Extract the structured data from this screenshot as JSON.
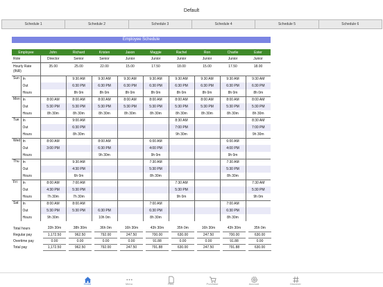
{
  "app": {
    "title": "Default"
  },
  "tabs": [
    "Schedule 1",
    "Schedule 2",
    "Schedule 3",
    "Schedule 4",
    "Schedule 5",
    "Schedule 6"
  ],
  "sheet": {
    "banner": "Employee Schedule",
    "header_label": "Employee",
    "role_label": "Role",
    "rate_label": "Hourly Rate (INR)",
    "employees": [
      {
        "name": "John",
        "role": "Director",
        "rate": "35.00"
      },
      {
        "name": "Richard",
        "role": "Senior",
        "rate": "25.00"
      },
      {
        "name": "Kristen",
        "role": "Senior",
        "rate": "22.00"
      },
      {
        "name": "Jason",
        "role": "Junior",
        "rate": "15.00"
      },
      {
        "name": "Maggie",
        "role": "Junior",
        "rate": "17.50"
      },
      {
        "name": "Rachel",
        "role": "Junior",
        "rate": "18.00"
      },
      {
        "name": "Ron",
        "role": "Junior",
        "rate": "15.00"
      },
      {
        "name": "Charlie",
        "role": "Junior",
        "rate": "17.50"
      },
      {
        "name": "Ester",
        "role": "Junior",
        "rate": "18.00"
      }
    ],
    "row_labels": [
      "In",
      "Out",
      "Hours"
    ],
    "days": [
      {
        "day": "Sun",
        "in": [
          "",
          "9:30 AM",
          "9:30 AM",
          "9:30 AM",
          "9:30 AM",
          "9:30 AM",
          "9:30 AM",
          "9:30 AM",
          "9:30 AM"
        ],
        "out": [
          "",
          "6:30 PM",
          "6:30 PM",
          "6:30 PM",
          "6:30 PM",
          "6:30 PM",
          "6:30 PM",
          "6:30 PM",
          "6:30 PM"
        ],
        "hours": [
          "",
          "8h 0m",
          "8h 0m",
          "8h 0m",
          "8h 0m",
          "8h 0m",
          "8h 0m",
          "8h 0m",
          "8h 0m"
        ]
      },
      {
        "day": "Mon",
        "in": [
          "8:00 AM",
          "8:00 AM",
          "8:00 AM",
          "8:00 AM",
          "8:00 AM",
          "8:00 AM",
          "8:00 AM",
          "8:00 AM",
          "8:00 AM"
        ],
        "out": [
          "5:30 PM",
          "5:30 PM",
          "5:30 PM",
          "5:30 PM",
          "5:30 PM",
          "5:30 PM",
          "5:30 PM",
          "5:30 PM",
          "5:30 PM"
        ],
        "hours": [
          "8h 30m",
          "8h 30m",
          "8h 30m",
          "8h 30m",
          "8h 30m",
          "8h 30m",
          "8h 30m",
          "8h 30m",
          "8h 30m"
        ]
      },
      {
        "day": "Tue",
        "in": [
          "",
          "9:00 AM",
          "",
          "",
          "",
          "8:30 AM",
          "",
          "",
          "8:30 AM"
        ],
        "out": [
          "",
          "6:30 PM",
          "",
          "",
          "",
          "7:00 PM",
          "",
          "",
          "7:00 PM"
        ],
        "hours": [
          "",
          "8h 30m",
          "",
          "",
          "",
          "9h 30m",
          "",
          "",
          "9h 30m"
        ]
      },
      {
        "day": "Wed",
        "in": [
          "8:00 AM",
          "",
          "8:00 AM",
          "",
          "6:00 AM",
          "",
          "",
          "6:00 AM",
          ""
        ],
        "out": [
          "3:00 PM",
          "",
          "6:30 PM",
          "",
          "4:00 PM",
          "",
          "",
          "4:00 PM",
          ""
        ],
        "hours": [
          "",
          "",
          "9h 30m",
          "",
          "9h 0m",
          "",
          "",
          "9h 0m",
          ""
        ]
      },
      {
        "day": "Thu",
        "in": [
          "",
          "9:30 AM",
          "",
          "",
          "7:30 AM",
          "",
          "",
          "7:30 AM",
          ""
        ],
        "out": [
          "",
          "4:30 PM",
          "",
          "",
          "5:30 PM",
          "",
          "",
          "5:30 PM",
          ""
        ],
        "hours": [
          "",
          "6h 0m",
          "",
          "",
          "8h 30m",
          "",
          "",
          "8h 30m",
          ""
        ]
      },
      {
        "day": "Fri",
        "in": [
          "8:00 AM",
          "7:00 AM",
          "",
          "",
          "",
          "7:30 AM",
          "",
          "",
          "7:30 AM"
        ],
        "out": [
          "4:30 PM",
          "5:30 PM",
          "",
          "",
          "",
          "5:30 PM",
          "",
          "",
          "5:30 PM"
        ],
        "hours": [
          "7h 30m",
          "7h 30m",
          "",
          "",
          "",
          "9h 0m",
          "",
          "",
          "9h 0m"
        ]
      },
      {
        "day": "Sat",
        "in": [
          "8:00 AM",
          "8:00 AM",
          "",
          "",
          "7:00 AM",
          "",
          "",
          "7:00 AM",
          ""
        ],
        "out": [
          "5:30 PM",
          "5:30 PM",
          "6:30 PM",
          "",
          "6:30 PM",
          "",
          "",
          "6:30 PM",
          ""
        ],
        "hours": [
          "9h 30m",
          "",
          "10h 0m",
          "",
          "8h 30m",
          "",
          "",
          "8h 30m",
          ""
        ]
      }
    ]
  },
  "totals": [
    {
      "label": "Total hours",
      "values": [
        "33h 30m",
        "38h 30m",
        "36h 0m",
        "16h 30m",
        "43h 30m",
        "35h 0m",
        "16h 30m",
        "43h 30m",
        "35h 0m"
      ]
    },
    {
      "label": "Regular pay",
      "values": [
        "1,172.50",
        "962.50",
        "792.00",
        "247.50",
        "700.00",
        "630.00",
        "247.50",
        "700.00",
        "630.00"
      ]
    },
    {
      "label": "Overtime pay",
      "values": [
        "0.00",
        "0.00",
        "0.00",
        "0.00",
        "91.88",
        "0.00",
        "0.00",
        "91.88",
        "0.00"
      ]
    },
    {
      "label": "Total pay",
      "values": [
        "1,172.50",
        "962.50",
        "792.00",
        "247.50",
        "791.88",
        "630.00",
        "247.50",
        "791.88",
        "630.00"
      ]
    }
  ],
  "bottom_nav": [
    {
      "label": "Home",
      "icon": "home-icon"
    },
    {
      "label": "Menu",
      "icon": "menu-icon"
    },
    {
      "label": "Files",
      "icon": "files-icon"
    },
    {
      "label": "Purchase",
      "icon": "cart-icon"
    },
    {
      "label": "Account",
      "icon": "gear-icon"
    },
    {
      "label": "Discover",
      "icon": "hash-icon"
    }
  ],
  "colors": {
    "accent": "#3b78d6",
    "banner": "#7b85e3",
    "header": "#3f8a2a",
    "row_shade": "#e9e9f7"
  }
}
